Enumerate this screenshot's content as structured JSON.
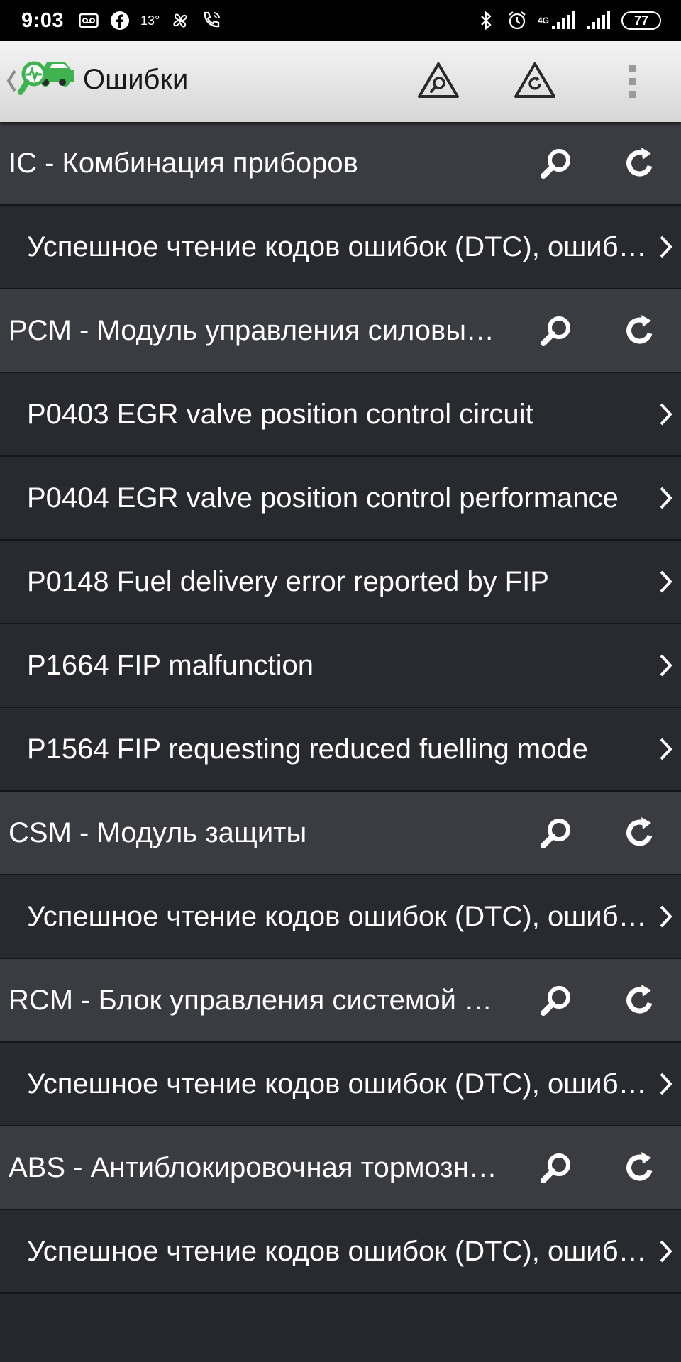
{
  "status_bar": {
    "time": "9:03",
    "temperature": "13°",
    "network": "4G",
    "battery": "77",
    "icons": [
      "voicemail-icon",
      "facebook-icon",
      "weather-temp",
      "fan-icon",
      "wifi-call-icon",
      "bluetooth-icon",
      "alarm-icon",
      "signal-icon",
      "signal-icon",
      "battery-icon"
    ]
  },
  "action_bar": {
    "title": "Ошибки",
    "icons": [
      "back-chevron-icon",
      "car-diagnostics-logo-icon",
      "scan-triangle-icon",
      "clear-triangle-icon",
      "overflow-menu-icon"
    ]
  },
  "groups": [
    {
      "title": "IC - Комбинация приборов",
      "items": [
        "Успешное чтение кодов ошибок (DTC), ошибок не обнаружено"
      ]
    },
    {
      "title": "PCM - Модуль управления силовым агрегатом",
      "items": [
        "P0403 EGR valve position control circuit",
        "P0404 EGR valve position control performance",
        "P0148 Fuel delivery error reported by FIP",
        "P1664 FIP malfunction",
        "P1564 FIP requesting reduced fuelling mode"
      ]
    },
    {
      "title": "CSM - Модуль защиты",
      "items": [
        "Успешное чтение кодов ошибок (DTC), ошибок не обнаружено"
      ]
    },
    {
      "title": "RCM - Блок управления системой безопасности",
      "items": [
        "Успешное чтение кодов ошибок (DTC), ошибок не обнаружено"
      ]
    },
    {
      "title": "ABS - Антиблокировочная тормозная система",
      "items": [
        "Успешное чтение кодов ошибок (DTC), ошибок не обнаружено"
      ]
    }
  ],
  "colors": {
    "status_bar_bg": "#000000",
    "action_bar_bg": "#e6e6e6",
    "group_row_bg": "#3a3c42",
    "item_row_bg": "#282a30",
    "logo_green": "#3fb34f",
    "text": "#ffffff"
  }
}
